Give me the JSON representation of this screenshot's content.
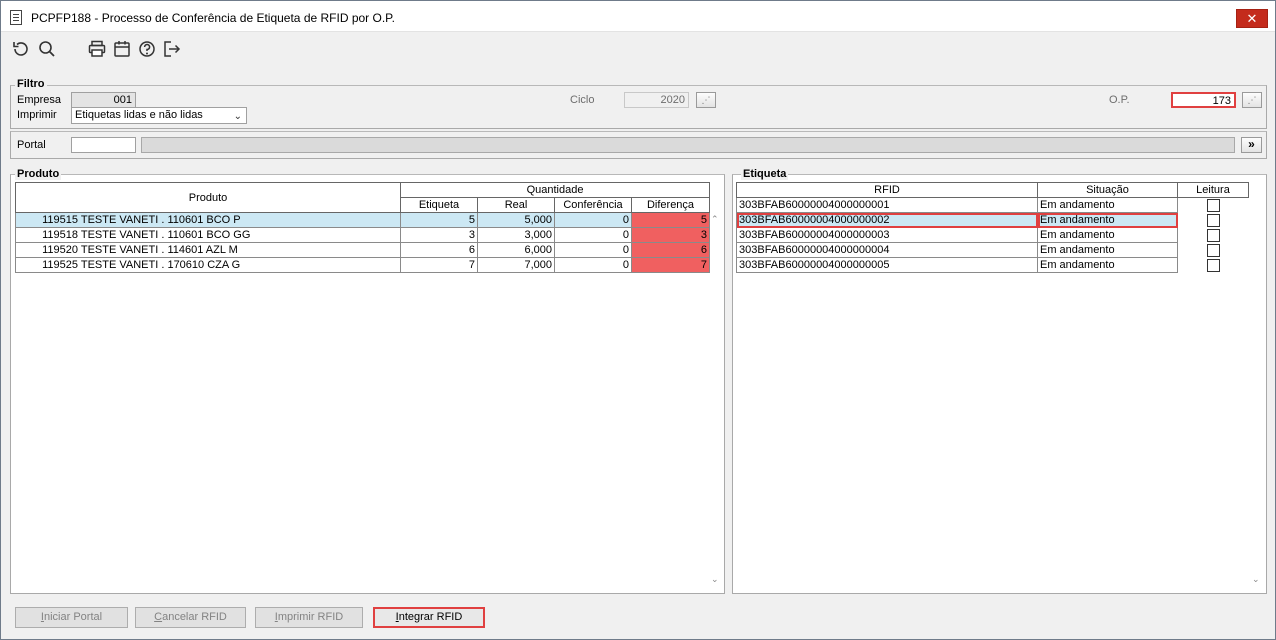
{
  "window": {
    "title": "PCPFP188 - Processo de Conferência de Etiqueta de RFID por O.P.",
    "close_label": "✕"
  },
  "toolbar": {
    "icons": [
      "refresh-icon",
      "search-icon",
      "print-icon",
      "calendar-icon",
      "help-icon",
      "exit-icon"
    ]
  },
  "filtro": {
    "title": "Filtro",
    "empresa_label": "Empresa",
    "empresa_value": "001",
    "imprimir_label": "Imprimir",
    "imprimir_value": "Etiquetas lidas e não lidas",
    "ciclo_label": "Ciclo",
    "ciclo_value": "2020",
    "op_label": "O.P.",
    "op_value": "173"
  },
  "portal": {
    "label": "Portal",
    "value": "",
    "go_label": "»"
  },
  "produto": {
    "title": "Produto",
    "header_produto": "Produto",
    "header_quantidade": "Quantidade",
    "columns": [
      "Etiqueta",
      "Real",
      "Conferência",
      "Diferença"
    ],
    "rows": [
      {
        "code": "119515",
        "name": "TESTE VANETI . 110601 BCO P",
        "etiqueta": "5",
        "real": "5,000",
        "conferencia": "0",
        "diferenca": "5"
      },
      {
        "code": "119518",
        "name": "TESTE VANETI . 110601 BCO GG",
        "etiqueta": "3",
        "real": "3,000",
        "conferencia": "0",
        "diferenca": "3"
      },
      {
        "code": "119520",
        "name": "TESTE VANETI . 114601 AZL M",
        "etiqueta": "6",
        "real": "6,000",
        "conferencia": "0",
        "diferenca": "6"
      },
      {
        "code": "119525",
        "name": "TESTE VANETI . 170610 CZA G",
        "etiqueta": "7",
        "real": "7,000",
        "conferencia": "0",
        "diferenca": "7"
      }
    ]
  },
  "etiqueta": {
    "title": "Etiqueta",
    "columns": [
      "RFID",
      "Situação",
      "Leitura"
    ],
    "rows": [
      {
        "rfid": "303BFAB60000004000000001",
        "situacao": "Em andamento"
      },
      {
        "rfid": "303BFAB60000004000000002",
        "situacao": "Em andamento"
      },
      {
        "rfid": "303BFAB60000004000000003",
        "situacao": "Em andamento"
      },
      {
        "rfid": "303BFAB60000004000000004",
        "situacao": "Em andamento"
      },
      {
        "rfid": "303BFAB60000004000000005",
        "situacao": "Em andamento"
      }
    ]
  },
  "buttons": {
    "iniciar_portal": {
      "first": "I",
      "rest": "niciar Portal"
    },
    "cancelar_rfid": {
      "first": "C",
      "rest": "ancelar RFID"
    },
    "imprimir_rfid": {
      "first": "I",
      "rest": "mprimir RFID"
    },
    "integrar_rfid": {
      "first": "I",
      "rest": "ntegrar RFID"
    }
  }
}
